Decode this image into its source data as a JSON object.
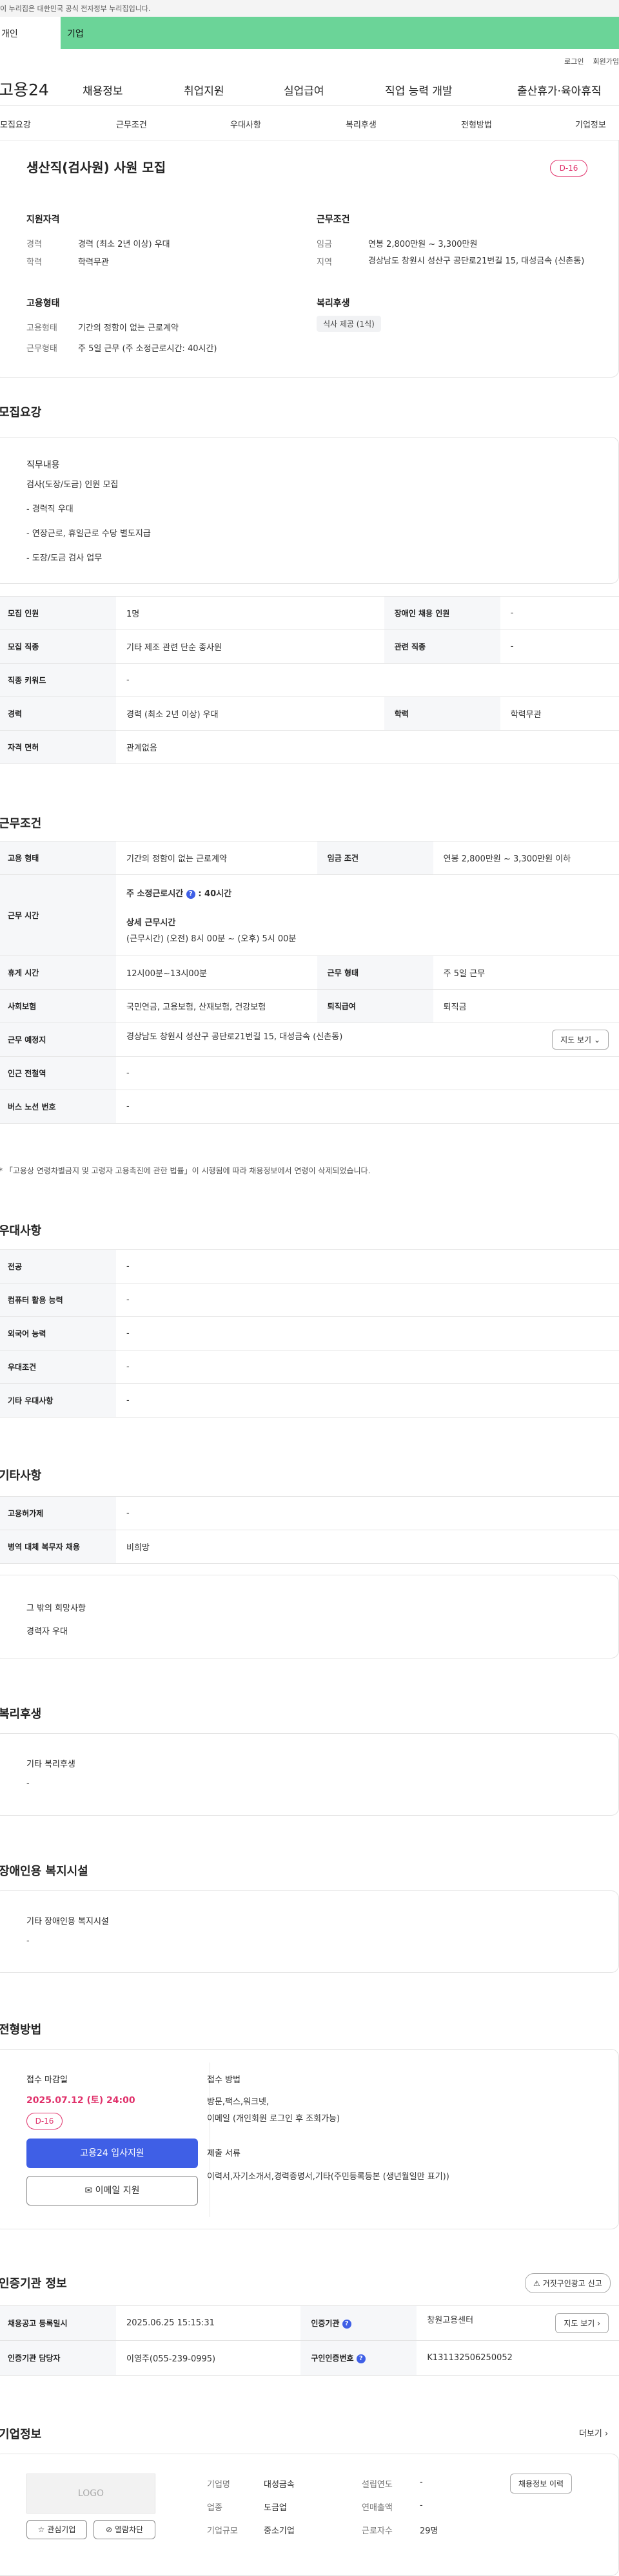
{
  "gov_banner": "이 누리집은 대한민국 공식 전자정부 누리집입니다.",
  "tabs": {
    "individual": "개인",
    "enterprise": "기업"
  },
  "util": {
    "login": "로그인",
    "join": "회원가입"
  },
  "logo": "고용24",
  "gnb": [
    "채용정보",
    "취업지원",
    "실업급여",
    "직업 능력 개발",
    "출산휴가·육아휴직"
  ],
  "anchor": [
    "모집요강",
    "근무조건",
    "우대사항",
    "복리후생",
    "전형방법",
    "기업정보"
  ],
  "summary": {
    "title": "생산직(검사원) 사원 모집",
    "dday": "D-16",
    "qual_title": "지원자격",
    "career_lbl": "경력",
    "career": "경력 (최소 2년 이상) 우대",
    "edu_lbl": "학력",
    "edu": "학력무관",
    "work_title": "근무조건",
    "wage_lbl": "임금",
    "wage": "연봉 2,800만원 ~ 3,300만원",
    "area_lbl": "지역",
    "area": "경상남도 창원시 성산구 공단로21번길 15, 대성금속 (신촌동)",
    "emp_title": "고용형태",
    "emp_lbl": "고용형태",
    "emp": "기간의 정함이 없는 근로계약",
    "time_lbl": "근무형태",
    "time": "주 5일 근무 (주 소정근로시간: 40시간)",
    "welfare_title": "복리후생",
    "welfare_tag": "식사 제공 (1식)"
  },
  "recruit": {
    "title": "모집요강",
    "duty_title": "직무내용",
    "duty_lines": [
      "검사(도장/도금) 인원 모집",
      "- 경력직 우대",
      "- 연장근로, 휴일근로 수당 별도지급",
      "- 도장/도금 검사 업무"
    ],
    "rows": [
      [
        "모집 인원",
        "1명",
        "장애인 채용 인원",
        "-"
      ],
      [
        "모집 직종",
        "기타 제조 관련 단순 종사원",
        "관련 직종",
        "-"
      ],
      [
        "직종 키워드",
        "-"
      ],
      [
        "경력",
        "경력 (최소 2년 이상) 우대",
        "학력",
        "학력무관"
      ],
      [
        "자격 면허",
        "관계없음"
      ]
    ]
  },
  "conditions": {
    "title": "근무조건",
    "type_lbl": "고용 형태",
    "type": "기간의 정함이 없는 근로계약",
    "pay_lbl": "임금 조건",
    "pay": "연봉 2,800만원 ~ 3,300만원 이하",
    "hours_lbl": "근무 시간",
    "std_hours": "주 소정근로시간",
    "std_hours_val": ": 40시간",
    "detail_title": "상세 근무시간",
    "detail": "(근무시간) (오전) 8시 00분 ~ (오후) 5시 00분",
    "rest_lbl": "휴게 시간",
    "rest": "12시00분~13시00분",
    "shift_lbl": "근무 형태",
    "shift": "주 5일 근무",
    "ins_lbl": "사회보험",
    "ins": "국민연금, 고용보험, 산재보험, 건강보험",
    "sev_lbl": "퇴직급여",
    "sev": "퇴직금",
    "addr_lbl": "근무 예정지",
    "addr": "경상남도 창원시 성산구 공단로21번길 15, 대성금속 (신촌동)",
    "map_btn": "지도 보기",
    "sub_lbl": "인근 전철역",
    "sub": "-",
    "bus_lbl": "버스 노선 번호",
    "bus": "-",
    "note": "* 「고용상 연령차별금지 및 고령자 고용촉진에 관한 법률」이 시행됨에 따라 채용정보에서 연령이 삭제되었습니다."
  },
  "pref": {
    "title": "우대사항",
    "rows": [
      [
        "전공",
        "-"
      ],
      [
        "컴퓨터 활용 능력",
        "-"
      ],
      [
        "외국어 능력",
        "-"
      ],
      [
        "우대조건",
        "-"
      ],
      [
        "기타 우대사항",
        "-"
      ]
    ]
  },
  "etc": {
    "title": "기타사항",
    "rows": [
      [
        "고용허가제",
        "-"
      ],
      [
        "병역 대체 복무자 채용",
        "비희망"
      ]
    ],
    "other_title": "그 밖의 희망사항",
    "other": "경력자 우대"
  },
  "welfare": {
    "title": "복리후생",
    "sub": "기타 복리후생",
    "val": "-"
  },
  "disab": {
    "title": "장애인용 복지시설",
    "sub": "기타 장애인용 복지시설",
    "val": "-"
  },
  "select": {
    "title": "전형방법",
    "deadline_title": "접수 마감일",
    "deadline": "2025.07.12 (토) 24:00",
    "dday": "D-16",
    "apply": "고용24 입사지원",
    "email_apply": "이메일 지원",
    "method_title": "접수 방법",
    "method": "방문,팩스,워크넷,",
    "method2": "이메일 (개인회원 로그인 후 조회가능)",
    "docs_title": "제출 서류",
    "docs": "이력서,자기소개서,경력증명서,기타(주민등록등본 (생년월일만 표기))"
  },
  "auth": {
    "title": "인증기관 정보",
    "report": "거짓구인광고 신고",
    "reg_lbl": "채용공고 등록일시",
    "reg": "2025.06.25 15:15:31",
    "org_lbl": "인증기관",
    "org": "창원고용센터",
    "map_btn": "지도 보기",
    "mgr_lbl": "인증기관 담당자",
    "mgr": "이영주(055-239-0995)",
    "no_lbl": "구인인증번호",
    "no": "K131132506250052"
  },
  "company": {
    "title": "기업정보",
    "more": "더보기",
    "logo": "LOGO",
    "fav": "관심기업",
    "block": "열람차단",
    "history_btn": "채용정보 이력",
    "name_lbl": "기업명",
    "name": "대성금속",
    "est_lbl": "설립연도",
    "est": "-",
    "ind_lbl": "업종",
    "ind": "도금업",
    "sales_lbl": "연매출액",
    "sales": "-",
    "size_lbl": "기업규모",
    "size": "중소기업",
    "emp_lbl": "근로자수",
    "emp": "29명"
  }
}
